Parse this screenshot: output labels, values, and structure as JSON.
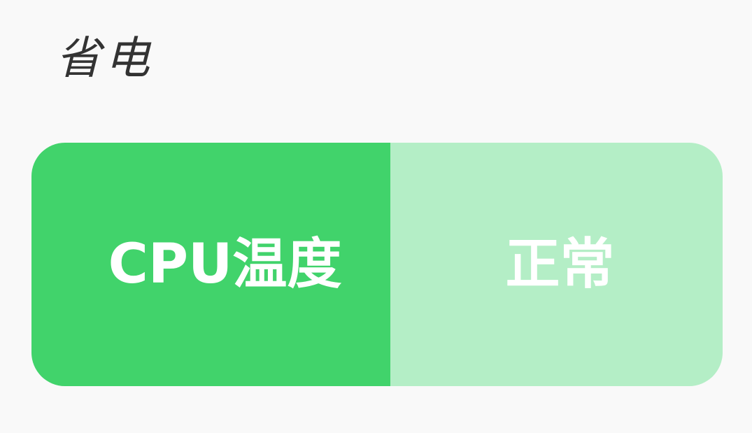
{
  "header": {
    "title": "省电"
  },
  "status_card": {
    "label": "CPU温度",
    "value": "正常"
  },
  "colors": {
    "background": "#f9f9f9",
    "label_panel": "#41d36b",
    "value_panel": "#b4eec6",
    "text": "#ffffff",
    "title_text": "#333333"
  }
}
